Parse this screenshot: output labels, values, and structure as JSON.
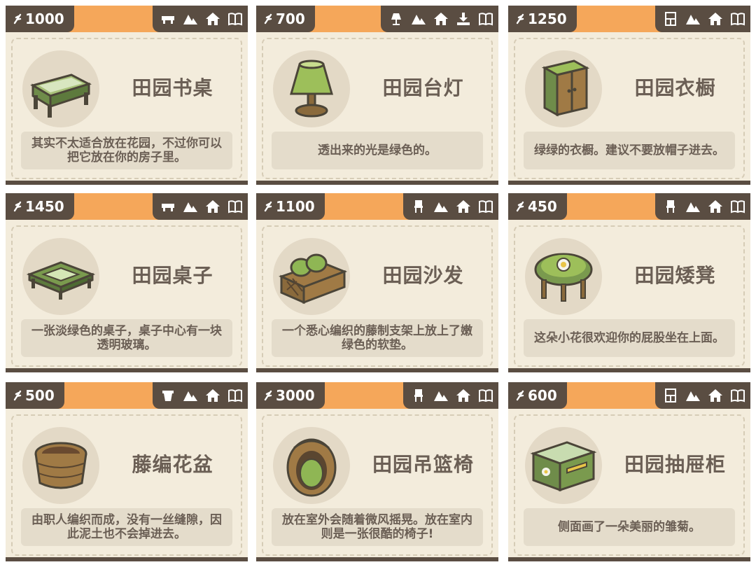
{
  "cards": [
    {
      "price": "1000",
      "name": "田园书桌",
      "desc": "其实不太适合放在花园，不过你可以把它放在你的房子里。",
      "icons": [
        "table-icon",
        "mountain-icon",
        "home-icon",
        "book-icon"
      ]
    },
    {
      "price": "700",
      "name": "田园台灯",
      "desc": "透出来的光是绿色的。",
      "icons": [
        "lamp-icon",
        "mountain-icon",
        "home-icon",
        "download-icon",
        "book-icon"
      ]
    },
    {
      "price": "1250",
      "name": "田园衣橱",
      "desc": "绿绿的衣橱。建议不要放帽子进去。",
      "icons": [
        "cabinet-icon",
        "mountain-icon",
        "home-icon",
        "book-icon"
      ]
    },
    {
      "price": "1450",
      "name": "田园桌子",
      "desc": "一张淡绿色的桌子，桌子中心有一块透明玻璃。",
      "icons": [
        "table-icon",
        "mountain-icon",
        "home-icon",
        "book-icon"
      ]
    },
    {
      "price": "1100",
      "name": "田园沙发",
      "desc": "一个悉心编织的藤制支架上放上了嫩绿色的软垫。",
      "icons": [
        "chair-icon",
        "mountain-icon",
        "home-icon",
        "book-icon"
      ]
    },
    {
      "price": "450",
      "name": "田园矮凳",
      "desc": "这朵小花很欢迎你的屁股坐在上面。",
      "icons": [
        "chair-icon",
        "mountain-icon",
        "home-icon",
        "book-icon"
      ]
    },
    {
      "price": "500",
      "name": "藤编花盆",
      "desc": "由职人编织而成，没有一丝缝隙，因此泥土也不会掉进去。",
      "icons": [
        "pot-icon",
        "mountain-icon",
        "home-icon",
        "book-icon"
      ]
    },
    {
      "price": "3000",
      "name": "田园吊篮椅",
      "desc": "放在室外会随着微风摇晃。放在室内则是一张很酷的椅子!",
      "icons": [
        "chair-icon",
        "mountain-icon",
        "home-icon",
        "book-icon"
      ]
    },
    {
      "price": "600",
      "name": "田园抽屉柜",
      "desc": "侧面画了一朵美丽的雏菊。",
      "icons": [
        "cabinet-icon",
        "mountain-icon",
        "home-icon",
        "book-icon"
      ]
    }
  ]
}
